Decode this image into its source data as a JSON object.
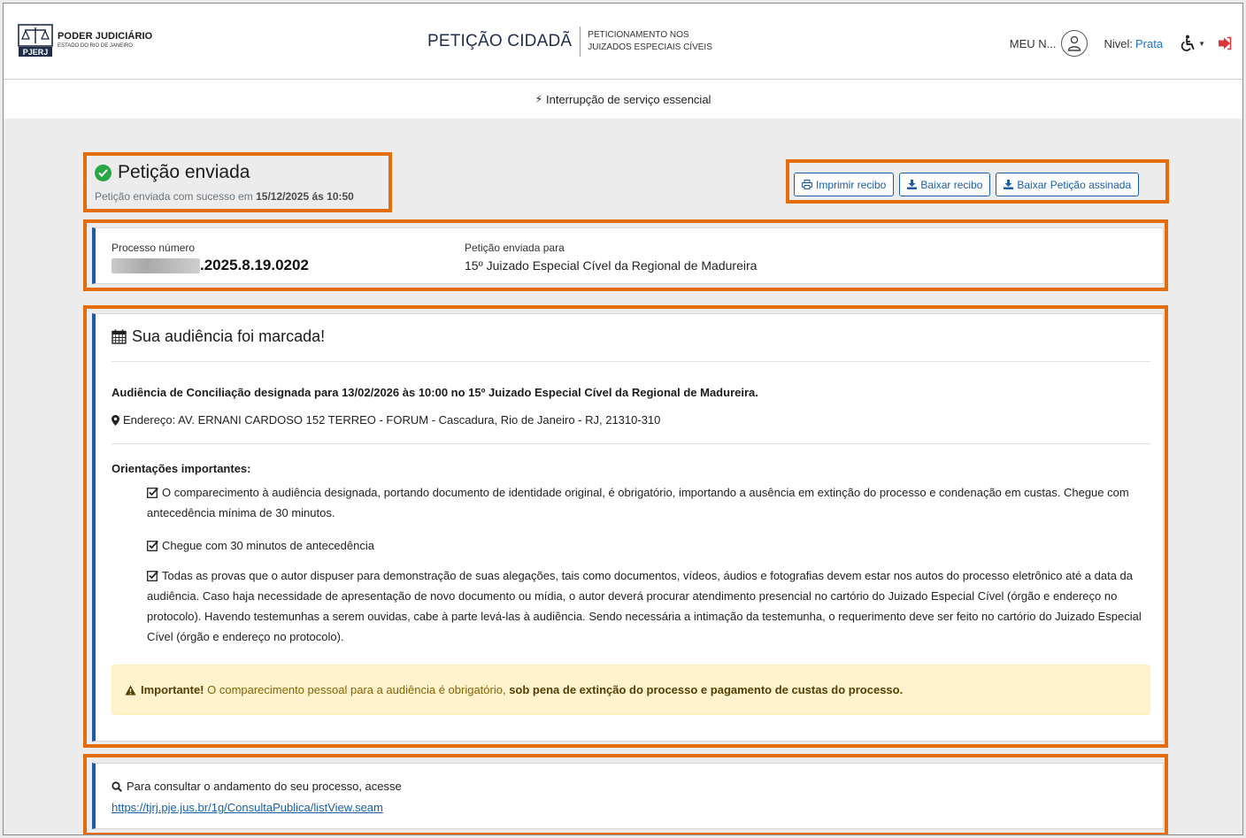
{
  "header": {
    "logo_title": "PODER JUDICIÁRIO",
    "logo_subtitle": "ESTADO DO RIO DE JANEIRO",
    "logo_badge": "PJERJ",
    "brand_title": "PETIÇÃO CIDADÃ",
    "brand_subtitle_line1": "PETICIONAMENTO NOS",
    "brand_subtitle_line2": "JUIZADOS ESPECIAIS CÍVEIS",
    "user_name": "MEU N...",
    "level_label": "Nivel:",
    "level_value": "Prata",
    "accessibility_icon": "wheelchair-icon",
    "logout_icon": "sign-out-icon"
  },
  "notice": {
    "text": "Interrupção de serviço essencial",
    "icon": "bolt-icon"
  },
  "status": {
    "title": "Petição enviada",
    "subtitle_prefix": "Petição enviada com sucesso em ",
    "subtitle_date": "15/12/2025 ás 10:50",
    "icon": "check-circle-icon"
  },
  "actions": {
    "print_receipt": "Imprimir recibo",
    "download_receipt": "Baixar recibo",
    "download_signed": "Baixar Petição assinada"
  },
  "process": {
    "number_label": "Processo número",
    "number_suffix": ".2025.8.19.0202",
    "destination_label": "Petição enviada para",
    "destination_value": "15º Juizado Especial Cível da Regional de Madureira"
  },
  "hearing": {
    "title": "Sua audiência foi marcada!",
    "main": "Audiência de Conciliação designada para 13/02/2026 às 10:00 no 15º Juizado Especial Cível da Regional de Madureira.",
    "address": "Endereço: AV. ERNANI CARDOSO 152 TERREO - FORUM - Cascadura, Rio de Janeiro - RJ, 21310-310",
    "orientations_title": "Orientações importantes:",
    "orientations": [
      "O comparecimento à audiência designada, portando documento de identidade original, é obrigatório, importando a ausência em extinção do processo e condenação em custas. Chegue com antecedência mínima de 30 minutos.",
      "Chegue com 30 minutos de antecedência",
      "Todas as provas que o autor dispuser para demonstração de suas alegações, tais como documentos, vídeos, áudios e fotografias devem estar nos autos do processo eletrônico até a data da audiência. Caso haja necessidade de apresentação de novo documento ou mídia, o autor deverá procurar atendimento presencial no cartório do Juizado Especial Cível (órgão e endereço no protocolo). Havendo testemunhas a serem ouvidas, cabe à parte levá-las à audiência. Sendo necessária a intimação da testemunha, o requerimento deve ser feito no cartório do Juizado Especial Cível (órgão e endereço no protocolo)."
    ],
    "warning_strong": "Importante!",
    "warning_text": " O comparecimento pessoal para a audiência é obrigatório, ",
    "warning_emphasis": "sob pena de extinção do processo e pagamento de custas do processo."
  },
  "consult": {
    "text": "Para consultar o andamento do seu processo, acesse",
    "link": "https://tjrj.pje.jus.br/1g/ConsultaPublica/listView.seam"
  },
  "colors": {
    "highlight": "#e46c0a",
    "card_accent": "#1f5aa6",
    "success": "#28a745",
    "link": "#1a5ea8",
    "level": "#1a74c9",
    "logout": "#d9363e"
  }
}
